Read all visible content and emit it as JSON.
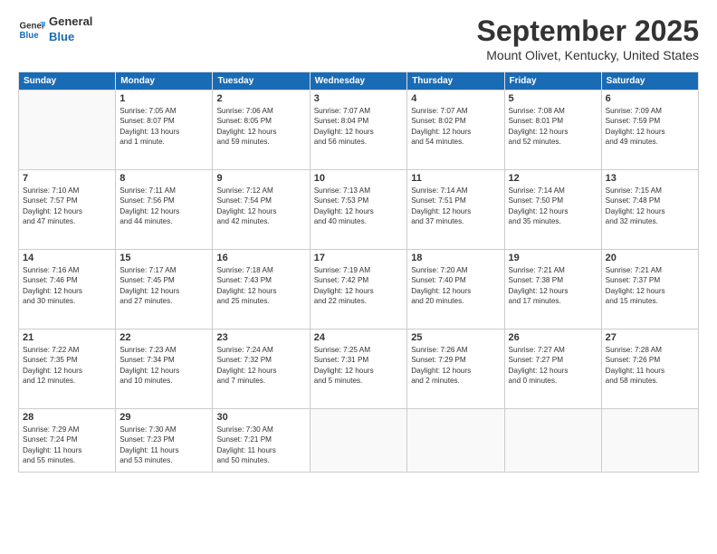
{
  "header": {
    "logo": {
      "line1": "General",
      "line2": "Blue"
    },
    "month": "September 2025",
    "location": "Mount Olivet, Kentucky, United States"
  },
  "days_of_week": [
    "Sunday",
    "Monday",
    "Tuesday",
    "Wednesday",
    "Thursday",
    "Friday",
    "Saturday"
  ],
  "weeks": [
    [
      {
        "day": "",
        "info": ""
      },
      {
        "day": "1",
        "info": "Sunrise: 7:05 AM\nSunset: 8:07 PM\nDaylight: 13 hours\nand 1 minute."
      },
      {
        "day": "2",
        "info": "Sunrise: 7:06 AM\nSunset: 8:05 PM\nDaylight: 12 hours\nand 59 minutes."
      },
      {
        "day": "3",
        "info": "Sunrise: 7:07 AM\nSunset: 8:04 PM\nDaylight: 12 hours\nand 56 minutes."
      },
      {
        "day": "4",
        "info": "Sunrise: 7:07 AM\nSunset: 8:02 PM\nDaylight: 12 hours\nand 54 minutes."
      },
      {
        "day": "5",
        "info": "Sunrise: 7:08 AM\nSunset: 8:01 PM\nDaylight: 12 hours\nand 52 minutes."
      },
      {
        "day": "6",
        "info": "Sunrise: 7:09 AM\nSunset: 7:59 PM\nDaylight: 12 hours\nand 49 minutes."
      }
    ],
    [
      {
        "day": "7",
        "info": "Sunrise: 7:10 AM\nSunset: 7:57 PM\nDaylight: 12 hours\nand 47 minutes."
      },
      {
        "day": "8",
        "info": "Sunrise: 7:11 AM\nSunset: 7:56 PM\nDaylight: 12 hours\nand 44 minutes."
      },
      {
        "day": "9",
        "info": "Sunrise: 7:12 AM\nSunset: 7:54 PM\nDaylight: 12 hours\nand 42 minutes."
      },
      {
        "day": "10",
        "info": "Sunrise: 7:13 AM\nSunset: 7:53 PM\nDaylight: 12 hours\nand 40 minutes."
      },
      {
        "day": "11",
        "info": "Sunrise: 7:14 AM\nSunset: 7:51 PM\nDaylight: 12 hours\nand 37 minutes."
      },
      {
        "day": "12",
        "info": "Sunrise: 7:14 AM\nSunset: 7:50 PM\nDaylight: 12 hours\nand 35 minutes."
      },
      {
        "day": "13",
        "info": "Sunrise: 7:15 AM\nSunset: 7:48 PM\nDaylight: 12 hours\nand 32 minutes."
      }
    ],
    [
      {
        "day": "14",
        "info": "Sunrise: 7:16 AM\nSunset: 7:46 PM\nDaylight: 12 hours\nand 30 minutes."
      },
      {
        "day": "15",
        "info": "Sunrise: 7:17 AM\nSunset: 7:45 PM\nDaylight: 12 hours\nand 27 minutes."
      },
      {
        "day": "16",
        "info": "Sunrise: 7:18 AM\nSunset: 7:43 PM\nDaylight: 12 hours\nand 25 minutes."
      },
      {
        "day": "17",
        "info": "Sunrise: 7:19 AM\nSunset: 7:42 PM\nDaylight: 12 hours\nand 22 minutes."
      },
      {
        "day": "18",
        "info": "Sunrise: 7:20 AM\nSunset: 7:40 PM\nDaylight: 12 hours\nand 20 minutes."
      },
      {
        "day": "19",
        "info": "Sunrise: 7:21 AM\nSunset: 7:38 PM\nDaylight: 12 hours\nand 17 minutes."
      },
      {
        "day": "20",
        "info": "Sunrise: 7:21 AM\nSunset: 7:37 PM\nDaylight: 12 hours\nand 15 minutes."
      }
    ],
    [
      {
        "day": "21",
        "info": "Sunrise: 7:22 AM\nSunset: 7:35 PM\nDaylight: 12 hours\nand 12 minutes."
      },
      {
        "day": "22",
        "info": "Sunrise: 7:23 AM\nSunset: 7:34 PM\nDaylight: 12 hours\nand 10 minutes."
      },
      {
        "day": "23",
        "info": "Sunrise: 7:24 AM\nSunset: 7:32 PM\nDaylight: 12 hours\nand 7 minutes."
      },
      {
        "day": "24",
        "info": "Sunrise: 7:25 AM\nSunset: 7:31 PM\nDaylight: 12 hours\nand 5 minutes."
      },
      {
        "day": "25",
        "info": "Sunrise: 7:26 AM\nSunset: 7:29 PM\nDaylight: 12 hours\nand 2 minutes."
      },
      {
        "day": "26",
        "info": "Sunrise: 7:27 AM\nSunset: 7:27 PM\nDaylight: 12 hours\nand 0 minutes."
      },
      {
        "day": "27",
        "info": "Sunrise: 7:28 AM\nSunset: 7:26 PM\nDaylight: 11 hours\nand 58 minutes."
      }
    ],
    [
      {
        "day": "28",
        "info": "Sunrise: 7:29 AM\nSunset: 7:24 PM\nDaylight: 11 hours\nand 55 minutes."
      },
      {
        "day": "29",
        "info": "Sunrise: 7:30 AM\nSunset: 7:23 PM\nDaylight: 11 hours\nand 53 minutes."
      },
      {
        "day": "30",
        "info": "Sunrise: 7:30 AM\nSunset: 7:21 PM\nDaylight: 11 hours\nand 50 minutes."
      },
      {
        "day": "",
        "info": ""
      },
      {
        "day": "",
        "info": ""
      },
      {
        "day": "",
        "info": ""
      },
      {
        "day": "",
        "info": ""
      }
    ]
  ]
}
